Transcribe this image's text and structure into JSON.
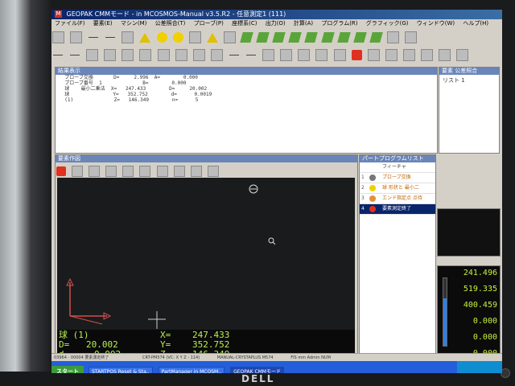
{
  "window": {
    "title": "GEOPAK CMMモード - in MCOSMOS-Manual v3.5.R2 - 任意測定1 (111)"
  },
  "menu": [
    "ファイル(F)",
    "要素(E)",
    "マシン(M)",
    "公差照合(T)",
    "プローブ(P)",
    "座標系(C)",
    "出力(O)",
    "計算(A)",
    "プログラム(R)",
    "グラフィック(G)",
    "ウィンドウ(W)",
    "ヘルプ(H)"
  ],
  "results": {
    "title": "結果表示",
    "rows": [
      "  プローブ交換       D=     2.996  A=        0.000",
      "  プローブ番号  1              B=        0.000",
      "",
      "  球    最小二乗法  X=   247.433        D=     20.002",
      "  球               Y=   352.752        d=      0.0019",
      "  (1)              Z=   146.349        n=      5"
    ]
  },
  "tree": {
    "title": "要素 公差照合",
    "items": [
      "リスト 1"
    ]
  },
  "graphics": {
    "title": "要素作図"
  },
  "readout": {
    "name": "球 (1)",
    "D_label": "D=",
    "D": "20.002",
    "d_label": "d=",
    "d": "0.002",
    "X_label": "X=",
    "X": "247.433",
    "Y_label": "Y=",
    "Y": "352.752",
    "Z_label": "Z=",
    "Z": "146.349"
  },
  "steps": {
    "title": "パートプログラムリスト",
    "col": "フィーチャ",
    "items": [
      {
        "num": "1",
        "label": "プローブ交換",
        "color": "#c06000"
      },
      {
        "num": "2",
        "label": "球    形状と 最小二",
        "color": "#c06000"
      },
      {
        "num": "3",
        "label": "エンド指定点  点待",
        "color": "#c06000"
      },
      {
        "num": "4",
        "label": "要素測定終了",
        "color": "#ffffff",
        "active": true
      }
    ]
  },
  "counter": {
    "x": "241.496",
    "y": "519.335",
    "z": "400.459",
    "a": "0.000",
    "b": "0.000",
    "c": "0.000"
  },
  "status": {
    "left": "03964 - 00004 要素測定終了",
    "mid": "CRT-PM574 (VC: X Y Z - 114)",
    "right": "MANUAL-CRYSTAPLUS M574",
    "units": "FIS  mm  Admin  NUM"
  },
  "taskbar": {
    "start": "スタート",
    "tasks": [
      "STARTPOS Reset & Sta..",
      "PartManager in MCOSM..",
      "GEOPAK CMMモード"
    ],
    "active_task": 2
  }
}
